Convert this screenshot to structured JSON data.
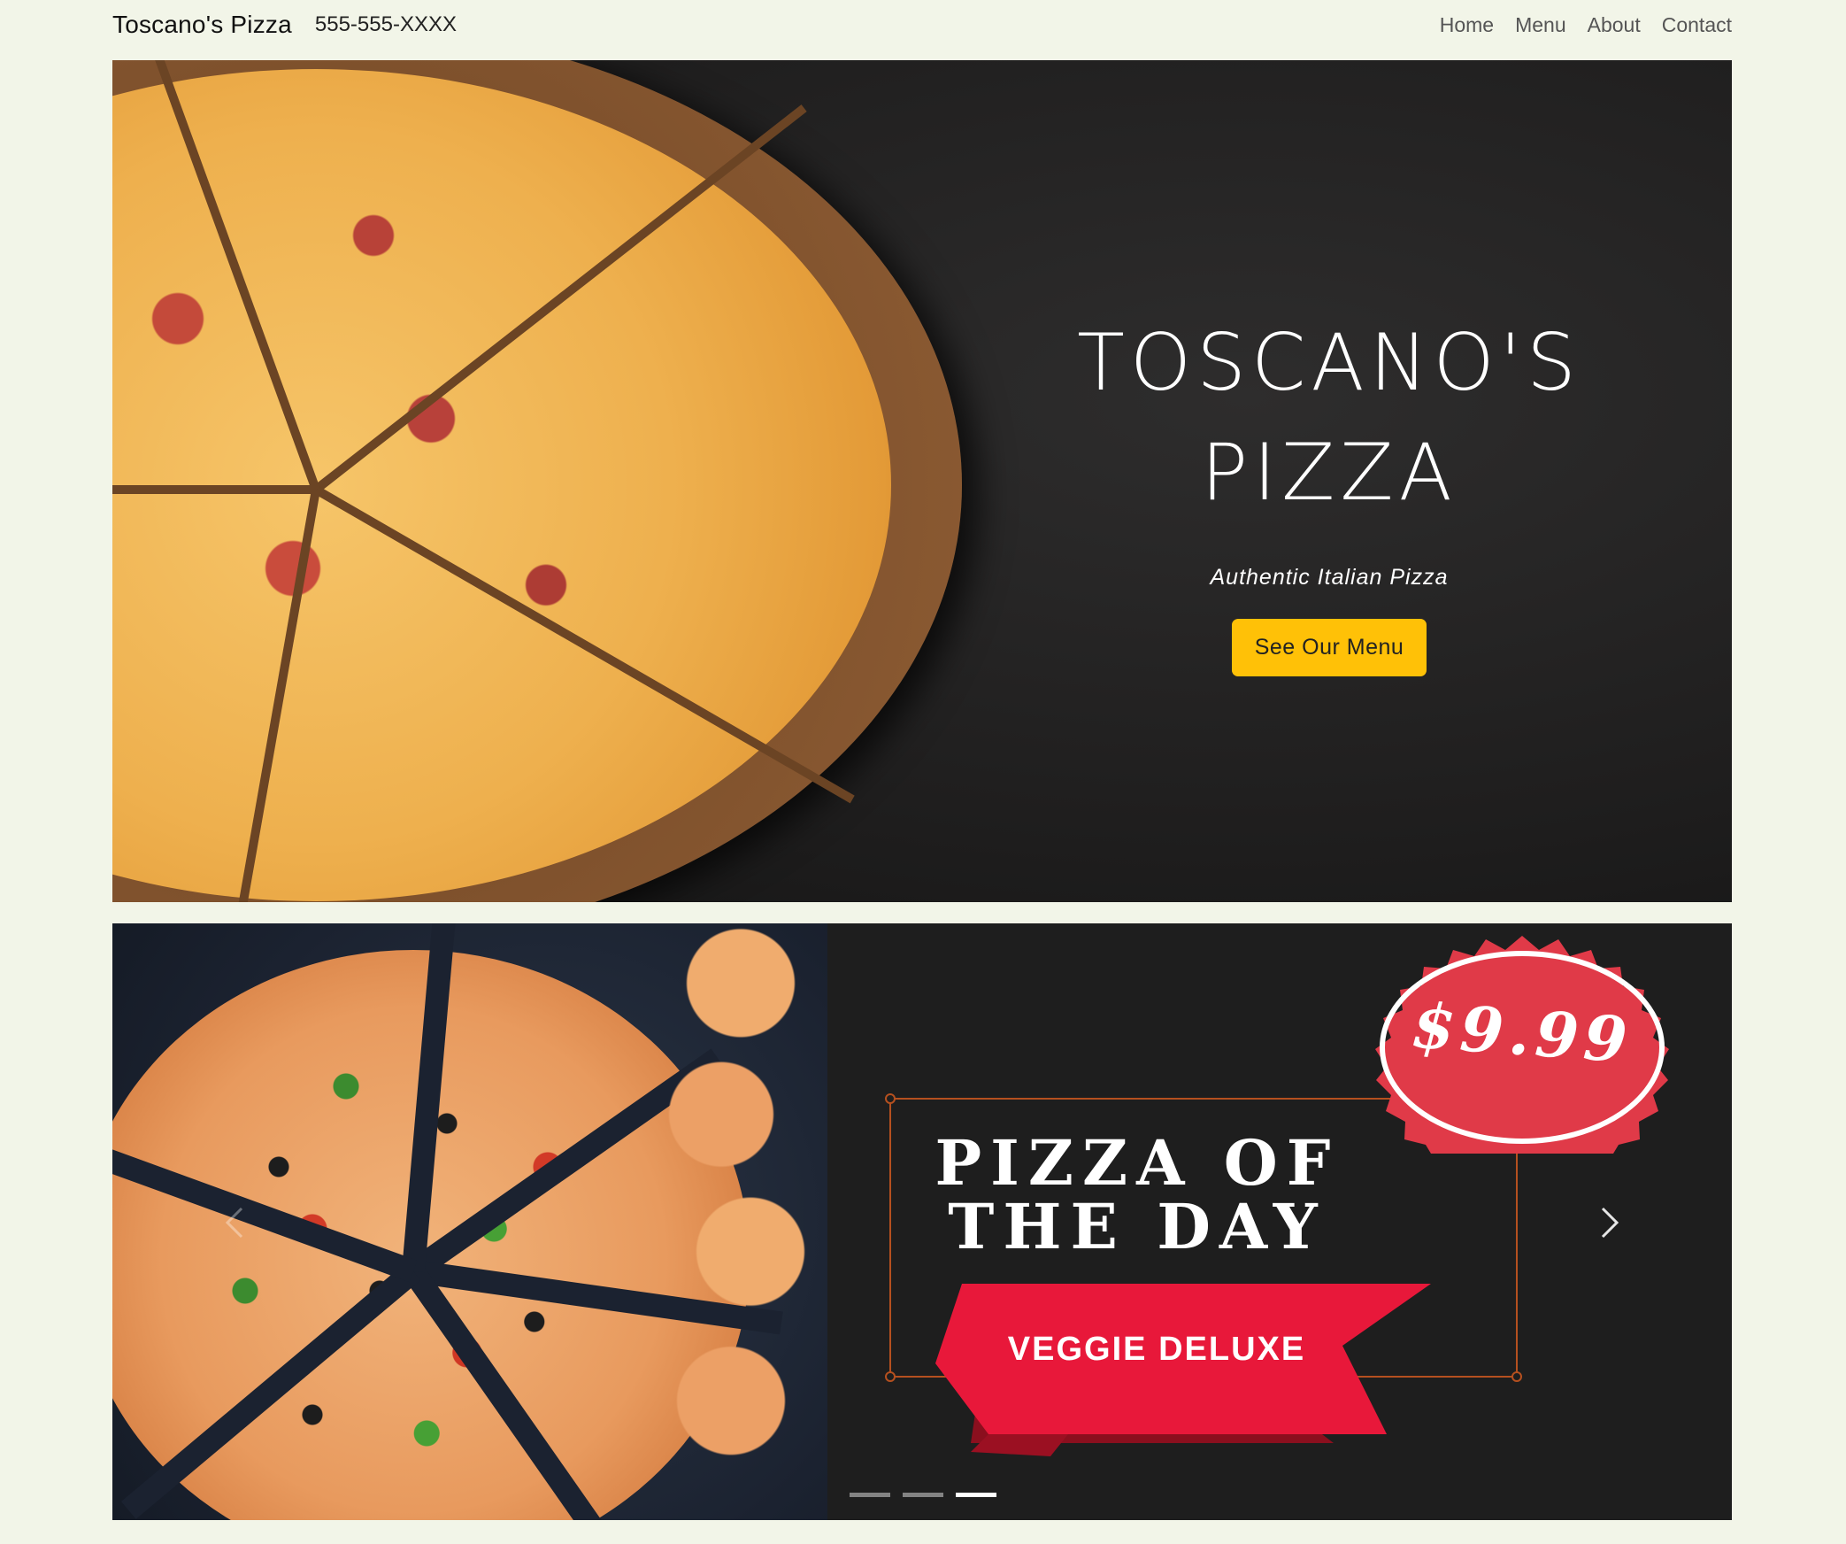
{
  "navbar": {
    "brand": "Toscano's Pizza",
    "phone": "555-555-XXXX",
    "links": [
      "Home",
      "Menu",
      "About",
      "Contact"
    ]
  },
  "hero": {
    "title_line1": "TOSCANO'S",
    "title_line2": "PIZZA",
    "subtitle": "Authentic Italian Pizza",
    "cta_label": "See Our Menu",
    "cta_color": "#ffc107"
  },
  "carousel": {
    "promo_title_line1": "PIZZA OF",
    "promo_title_line2": "THE DAY",
    "special_name": "VEGGIE DELUXE",
    "price": "$9.99",
    "badge_color": "#e03a48",
    "ribbon_color": "#e8183a",
    "indicator_count": 3,
    "active_indicator": 3,
    "prev_icon": "chevron-left-icon",
    "next_icon": "chevron-right-icon"
  }
}
